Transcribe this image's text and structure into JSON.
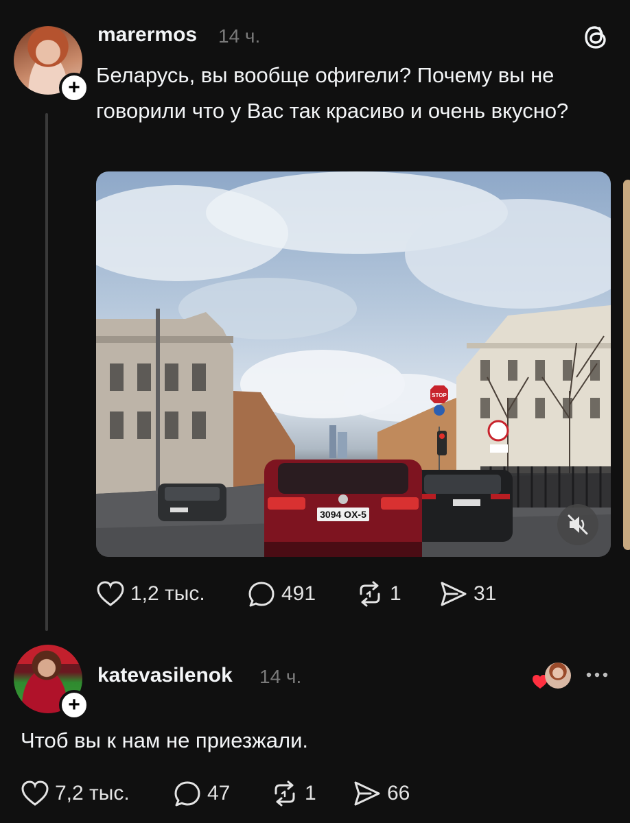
{
  "post": {
    "username": "marermos",
    "time": "14 ч.",
    "text": "Беларусь, вы вообще офигели? Почему вы не говорили что у Вас так красиво и очень вкусно?",
    "plate_front": "3094 OX-5",
    "stop_sign": "STOP",
    "likes": "1,2 тыс.",
    "comments": "491",
    "reposts": "1",
    "shares": "31"
  },
  "reply": {
    "username": "katevasilenok",
    "time": "14 ч.",
    "text": "Чтоб вы к нам не приезжали.",
    "likes": "7,2 тыс.",
    "comments": "47",
    "reposts": "1",
    "shares": "66"
  },
  "icons": {
    "threads": "threads-logo-icon",
    "follow": "plus-icon",
    "like": "heart-icon",
    "comment": "comment-bubble-icon",
    "repost": "repost-icon",
    "share": "send-icon",
    "mute": "speaker-muted-icon",
    "more": "more-dots-icon"
  },
  "colors": {
    "background": "#101010",
    "text": "#f3f5f7",
    "muted": "#7a7a7a",
    "like_red": "#ff3040"
  }
}
